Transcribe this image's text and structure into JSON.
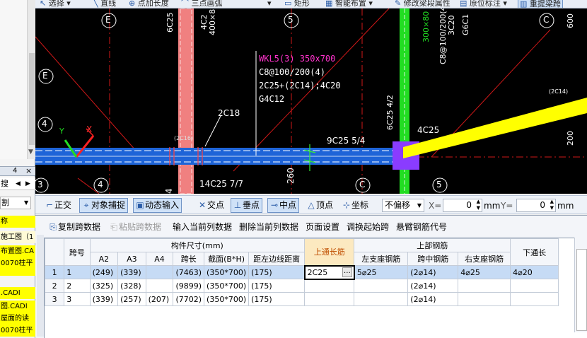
{
  "top_toolbar": {
    "items": [
      {
        "label": "选择",
        "icon": "pointer-icon"
      },
      {
        "label": "直线",
        "icon": "line-icon"
      },
      {
        "label": "点加长度",
        "icon": "point-length-icon"
      },
      {
        "label": "三点画弧",
        "icon": "arc-icon"
      },
      {
        "label": "矩形",
        "icon": "rectangle-icon"
      },
      {
        "label": "智能布置",
        "icon": "smart-layout-icon"
      },
      {
        "label": "修改梁段属性",
        "icon": "edit-beam-icon"
      },
      {
        "label": "原位标注",
        "icon": "in-situ-annotation-icon"
      },
      {
        "label": "重提梁跨",
        "icon": "re-extract-span-icon"
      }
    ]
  },
  "left_panel": {
    "labels": [
      "称",
      "施工图（1",
      "布置图.CA",
      "0070柱平",
      "",
      "",
      ".CADI",
      "图.CADI",
      "屋面的读",
      "0070柱平"
    ],
    "header_text": "搜",
    "pin_label": "4",
    "close_label": "×",
    "field_text": "割"
  },
  "canvas": {
    "axis_labels": [
      "E",
      "5",
      "C",
      "E",
      "4",
      "4",
      "5",
      "C",
      "3",
      "5"
    ],
    "beam_annotation": {
      "line1": "WKL5(3) 350x700",
      "line2": "C8@100/200(4)",
      "line3": "2C25+(2C14);4C20",
      "line4": "G4C12"
    },
    "labels": {
      "c2_18": "2C18",
      "c2_16": "(2C16)",
      "c9_25": "9C25 5/4",
      "c6_25": "6C25 4/2",
      "c4_25": "4C25",
      "c2_14": "(2C14)",
      "c14_25": "14C25 7/7",
      "n260": "260",
      "n4": "4",
      "v6c25": "6C25",
      "v4c2": "4C2",
      "v400": "400×8",
      "v300": "300×80",
      "v8_100": "C8@100/200(4)",
      "v3c20": "3C20",
      "v6g1": "G6C1",
      "v600": "600",
      "v200": "200",
      "x_label": "X",
      "y_label": "Y"
    }
  },
  "snap_bar": {
    "ortho": "正交",
    "object_snap": "对象捕捉",
    "dynamic_input": "动态输入",
    "intersection": "交点",
    "perpendicular": "垂点",
    "midpoint": "中点",
    "vertex": "顶点",
    "coordinate": "坐标",
    "offset_select": "不偏移",
    "x_label": "X=",
    "x_value": "0",
    "x_unit": "mm",
    "y_label": "Y=",
    "y_value": "0",
    "y_unit": "mm"
  },
  "grid_toolbar": {
    "copy_span": "复制跨数据",
    "paste_span": "粘贴跨数据",
    "input_col": "输入当前列数据",
    "delete_col": "删除当前列数据",
    "page_setup": "页面设置",
    "adjust_start": "调换起始跨",
    "cantilever": "悬臂钢筋代号"
  },
  "grid": {
    "group_headers": {
      "span_no": "跨号",
      "dimensions": "构件尺寸(mm)",
      "top_through": "上通长筋",
      "top_bars": "上部钢筋",
      "bottom_through": "下通长"
    },
    "columns": [
      "A2",
      "A3",
      "A4",
      "跨长",
      "截面(B*H)",
      "距左边线距离",
      "左支座钢筋",
      "跨中钢筋",
      "右支座钢筋"
    ],
    "rows": [
      {
        "n": "1",
        "span": "1",
        "a2": "(249)",
        "a3": "(339)",
        "a4": "",
        "len": "(7463)",
        "sec": "(350*700)",
        "dist": "(175)",
        "top": "2C25",
        "left": "5⌀25",
        "mid": "(2⌀14)",
        "right": "4⌀25",
        "bot": "4⌀20"
      },
      {
        "n": "2",
        "span": "2",
        "a2": "(325)",
        "a3": "(328)",
        "a4": "",
        "len": "(9899)",
        "sec": "(350*700)",
        "dist": "(175)",
        "top": "",
        "left": "",
        "mid": "(2⌀14)",
        "right": "",
        "bot": ""
      },
      {
        "n": "3",
        "span": "3",
        "a2": "(339)",
        "a3": "(257)",
        "a4": "(207)",
        "len": "(7702)",
        "sec": "(350*700)",
        "dist": "(175)",
        "top": "",
        "left": "",
        "mid": "(2⌀14)",
        "right": "",
        "bot": ""
      }
    ],
    "ellipsis": "…"
  },
  "colors": {
    "canvas_bg": "#000000",
    "beam_blue": "#1e64d8",
    "column_red": "#f08080",
    "column_green": "#22dd22",
    "beam_yellow": "#ffff00",
    "annotation_magenta": "#ff33cc",
    "selection_blue": "#c6dbf5",
    "highlight_orange": "#c04e00"
  }
}
